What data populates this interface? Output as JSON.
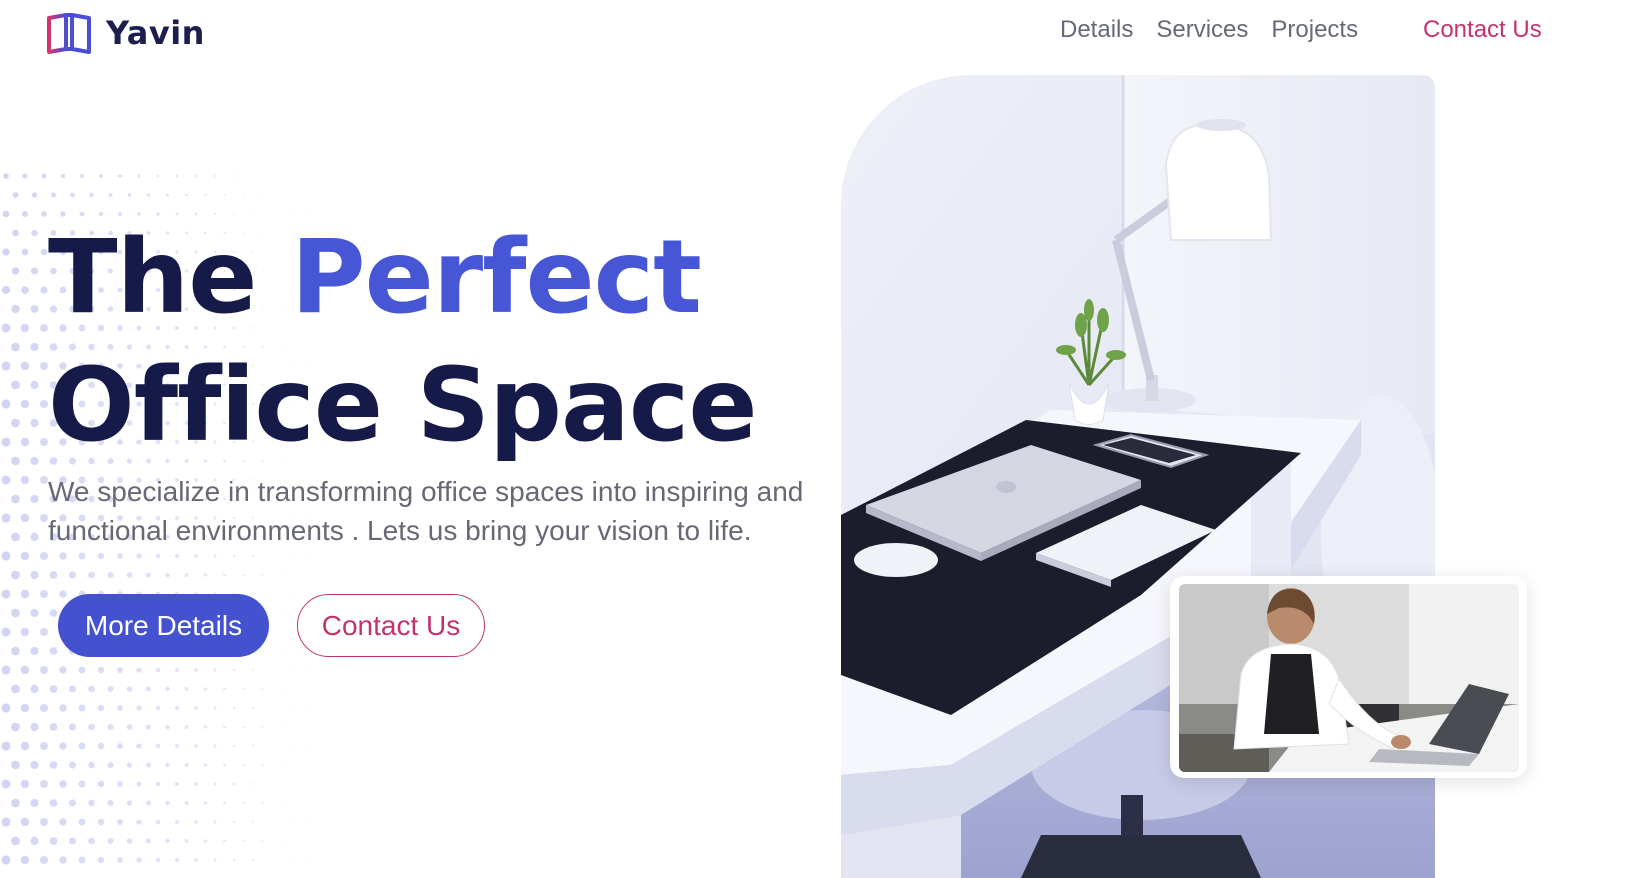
{
  "header": {
    "brand": "Yavin",
    "nav": [
      "Details",
      "Services",
      "Projects"
    ],
    "contact_label": "Contact Us"
  },
  "hero": {
    "title_part1": "The",
    "title_accent": "Perfect",
    "title_line2": "Office Space",
    "subtitle": "We specialize in transforming office spaces into inspiring and functional environments . Lets us bring your vision to life.",
    "primary_button": "More Details",
    "secondary_button": "Contact Us"
  },
  "colors": {
    "primary": "#4452d0",
    "accent_pink": "#c4326f",
    "heading": "#161a48",
    "body_text": "#666875"
  },
  "icons": {
    "logo": "open-book-logo-icon"
  },
  "images": {
    "main": "desk-with-laptop-lamp-plant-photo",
    "inset": "woman-working-at-laptop-photo"
  }
}
